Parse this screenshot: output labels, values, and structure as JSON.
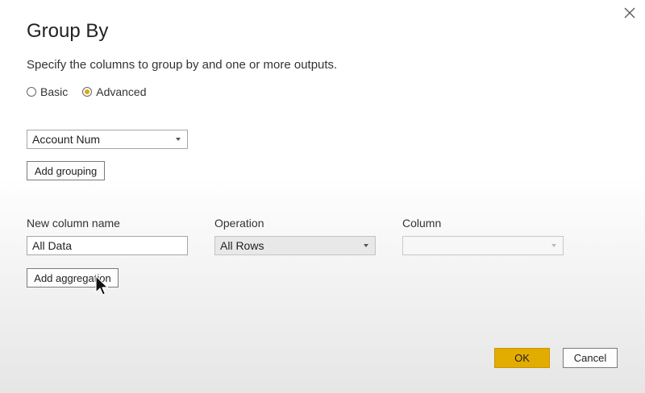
{
  "dialog": {
    "title": "Group By",
    "subtitle": "Specify the columns to group by and one or more outputs."
  },
  "mode": {
    "options": [
      {
        "label": "Basic",
        "checked": false
      },
      {
        "label": "Advanced",
        "checked": true
      }
    ]
  },
  "grouping": {
    "selected": "Account Num",
    "add_label": "Add grouping"
  },
  "aggregation": {
    "headers": {
      "new_column_name": "New column name",
      "operation": "Operation",
      "column": "Column"
    },
    "new_column_value": "All Data",
    "operation_value": "All Rows",
    "column_value": "",
    "add_label": "Add aggregation"
  },
  "footer": {
    "ok_label": "OK",
    "cancel_label": "Cancel"
  },
  "colors": {
    "accent": "#e2ac00"
  },
  "icons": {
    "close": "close-icon",
    "dropdown": "chevron-down-icon",
    "cursor": "mouse-pointer-icon"
  }
}
